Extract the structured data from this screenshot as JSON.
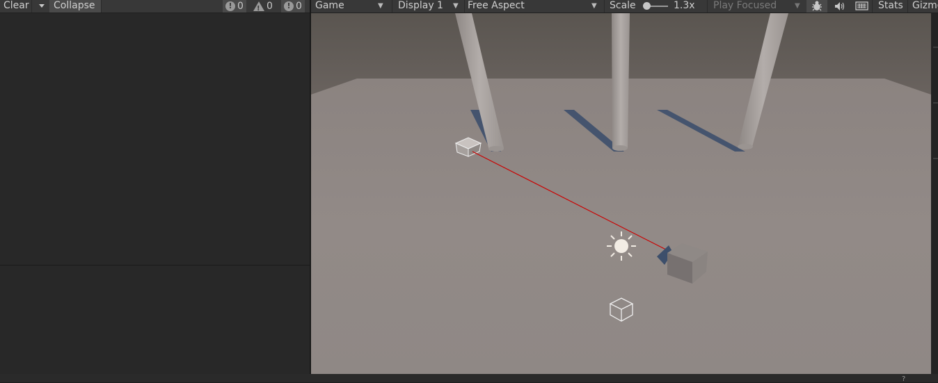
{
  "console": {
    "toolbar": {
      "clear_label": "Clear",
      "collapse_label": "Collapse",
      "log_count": "0",
      "warning_count": "0",
      "error_count": "0"
    }
  },
  "game": {
    "toolbar": {
      "tab_label": "Game",
      "display_label": "Display 1",
      "aspect_label": "Free Aspect",
      "scale_label": "Scale",
      "scale_value": "1.3x",
      "play_mode_label": "Play Focused",
      "stats_label": "Stats",
      "gizmos_label": "Gizmos"
    }
  },
  "colors": {
    "editor_bg": "#282828",
    "toolbar_bg": "#383838",
    "ground": "#8f8784",
    "sky": "#5f5955",
    "pillar": "#a9a3a0",
    "shadow": "#3d4f6b",
    "ray": "#cc0000"
  }
}
